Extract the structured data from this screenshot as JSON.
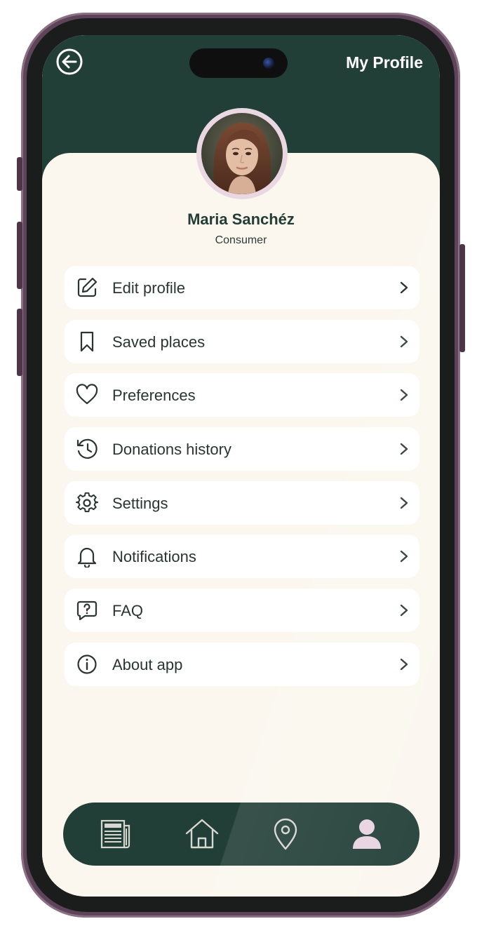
{
  "header": {
    "title": "My Profile",
    "back_icon": "arrow-left-circle-icon"
  },
  "profile": {
    "name": "Maria Sanchéz",
    "role": "Consumer"
  },
  "menu": {
    "items": [
      {
        "label": "Edit profile",
        "icon": "edit-icon"
      },
      {
        "label": "Saved places",
        "icon": "bookmark-icon"
      },
      {
        "label": "Preferences",
        "icon": "heart-icon"
      },
      {
        "label": "Donations history",
        "icon": "history-icon"
      },
      {
        "label": "Settings",
        "icon": "gear-icon"
      },
      {
        "label": "Notifications",
        "icon": "bell-icon"
      },
      {
        "label": "FAQ",
        "icon": "question-chat-icon"
      },
      {
        "label": "About app",
        "icon": "info-icon"
      }
    ]
  },
  "bottom_nav": {
    "items": [
      {
        "icon": "newspaper-icon",
        "active": false
      },
      {
        "icon": "home-icon",
        "active": false
      },
      {
        "icon": "location-pin-icon",
        "active": false
      },
      {
        "icon": "user-icon",
        "active": true
      }
    ]
  },
  "colors": {
    "header": "#223f37",
    "background": "#fbf7ef",
    "card": "#ffffff",
    "text": "#2a3532",
    "accent_active": "#e9d3e0",
    "frame": "#5e4458"
  }
}
